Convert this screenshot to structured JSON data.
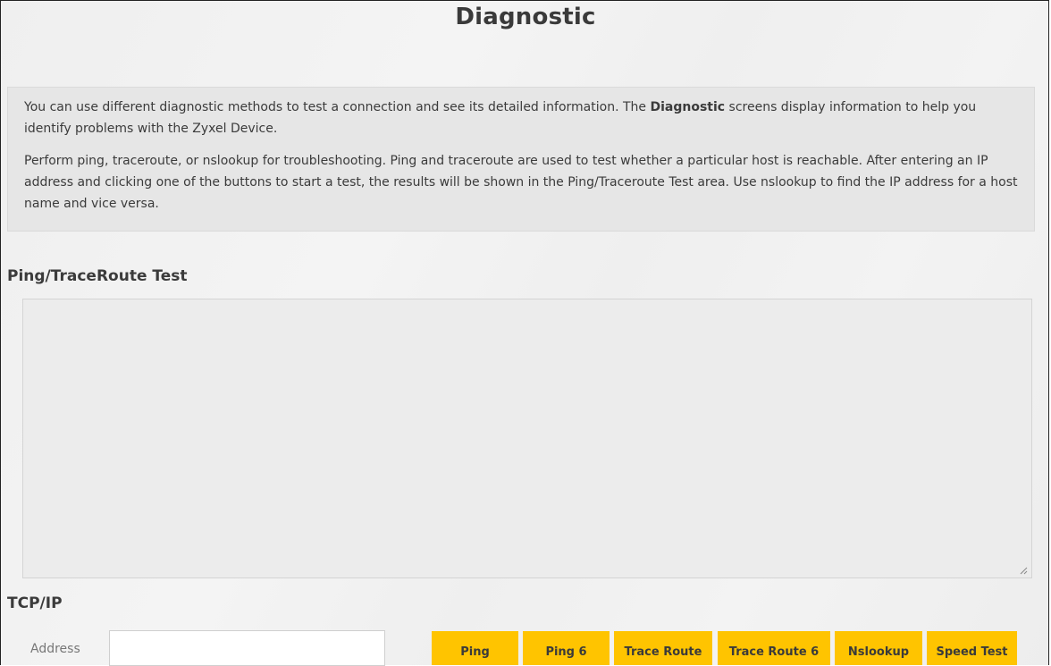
{
  "page": {
    "title": "Diagnostic"
  },
  "description": {
    "p1_before": "You can use different diagnostic methods to test a connection and see its detailed information. The ",
    "p1_bold": "Diagnostic",
    "p1_after": " screens display information to help you identify problems with the Zyxel Device.",
    "p2": "Perform ping, traceroute, or nslookup for troubleshooting. Ping and traceroute are used to test whether a particular host is reachable. After entering an IP address and clicking one of the buttons to start a test, the results will be shown in the Ping/Traceroute Test area. Use nslookup to find the IP address for a host name and vice versa."
  },
  "ping_section": {
    "title": "Ping/TraceRoute Test",
    "result_text": ""
  },
  "tcpip_section": {
    "title": "TCP/IP",
    "address_label": "Address",
    "address_value": "",
    "buttons": [
      "Ping",
      "Ping 6",
      "Trace Route",
      "Trace Route 6",
      "Nslookup",
      "Speed Test"
    ]
  },
  "colors": {
    "button": "#ffc400",
    "background": "#f1f1f1",
    "description_box": "#e6e6e6"
  }
}
